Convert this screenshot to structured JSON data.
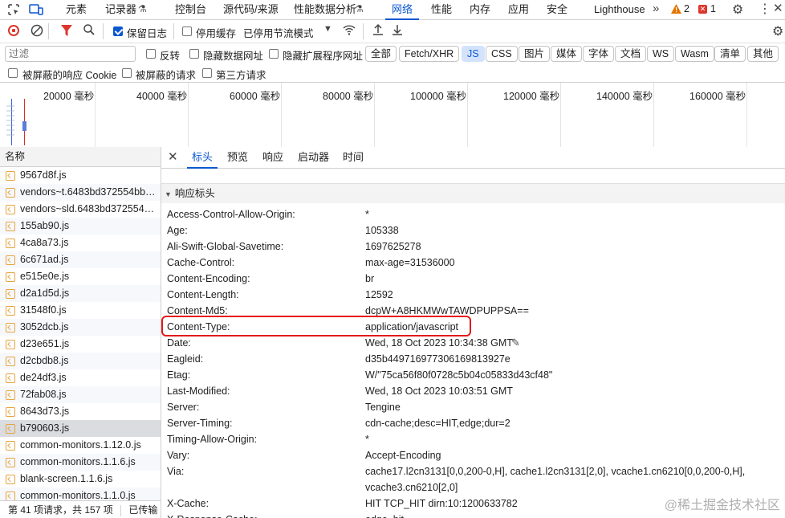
{
  "top_tabs": [
    "元素",
    "记录器",
    "控制台",
    "源代码/来源",
    "性能数据分析",
    "网络",
    "性能",
    "内存",
    "应用",
    "安全",
    "Lighthouse"
  ],
  "top_badges": {
    "warnings": "2",
    "errors": "1"
  },
  "toolbar": {
    "preserve_log": "保留日志",
    "disable_cache": "停用缓存",
    "throttle": "已停用节流模式"
  },
  "filter": {
    "placeholder": "过滤",
    "invert": "反转",
    "hide_data_urls": "隐藏数据网址",
    "hide_ext_urls": "隐藏扩展程序网址"
  },
  "type_filters": [
    "全部",
    "Fetch/XHR",
    "JS",
    "CSS",
    "图片",
    "媒体",
    "字体",
    "文档",
    "WS",
    "Wasm",
    "清单",
    "其他"
  ],
  "type_selected": "JS",
  "filter2": [
    "被屏蔽的响应 Cookie",
    "被屏蔽的请求",
    "第三方请求"
  ],
  "timeline_ticks": [
    "20000 毫秒",
    "40000 毫秒",
    "60000 毫秒",
    "80000 毫秒",
    "100000 毫秒",
    "120000 毫秒",
    "140000 毫秒",
    "160000 毫秒"
  ],
  "left": {
    "header": "名称",
    "files": [
      "9567d8f.js",
      "vendors~t.6483bd372554bb…",
      "vendors~sld.6483bd372554b…",
      "155ab90.js",
      "4ca8a73.js",
      "6c671ad.js",
      "e515e0e.js",
      "d2a1d5d.js",
      "31548f0.js",
      "3052dcb.js",
      "d23e651.js",
      "d2cbdb8.js",
      "de24df3.js",
      "72fab08.js",
      "8643d73.js",
      "b790603.js",
      "common-monitors.1.12.0.js",
      "common-monitors.1.1.6.js",
      "blank-screen.1.1.6.js",
      "common-monitors.1.1.0.js"
    ],
    "selected_file": "b790603.js",
    "status": "第 41 项请求，共 157 项",
    "status2": "已传输"
  },
  "detail_tabs": [
    "标头",
    "预览",
    "响应",
    "启动器",
    "时间"
  ],
  "section_title": "响应标头",
  "headers": [
    {
      "k": "Access-Control-Allow-Origin:",
      "v": "*"
    },
    {
      "k": "Age:",
      "v": "105338"
    },
    {
      "k": "Ali-Swift-Global-Savetime:",
      "v": "1697625278"
    },
    {
      "k": "Cache-Control:",
      "v": "max-age=31536000"
    },
    {
      "k": "Content-Encoding:",
      "v": "br"
    },
    {
      "k": "Content-Length:",
      "v": "12592"
    },
    {
      "k": "Content-Md5:",
      "v": "dcpW+A8HKMWwTAWDPUPPSA=="
    },
    {
      "k": "Content-Type:",
      "v": "application/javascript"
    },
    {
      "k": "Date:",
      "v": "Wed, 18 Oct 2023 10:34:38 GMT"
    },
    {
      "k": "Eagleid:",
      "v": "d35b4497169773061698​13927e"
    },
    {
      "k": "Etag:",
      "v": "W/\"75ca56f80f0728c5b04c05833d43cf48\""
    },
    {
      "k": "Last-Modified:",
      "v": "Wed, 18 Oct 2023 10:03:51 GMT"
    },
    {
      "k": "Server:",
      "v": "Tengine"
    },
    {
      "k": "Server-Timing:",
      "v": "cdn-cache;desc=HIT,edge;dur=2"
    },
    {
      "k": "Timing-Allow-Origin:",
      "v": "*"
    },
    {
      "k": "Vary:",
      "v": "Accept-Encoding"
    },
    {
      "k": "Via:",
      "v": "cache17.l2cn3131[0,0,200-0,H], cache1.l2cn3131[2,0], vcache1.cn6210[0,0,200-0,H],"
    },
    {
      "k": "",
      "v": "vcache3.cn6210[2,0]"
    },
    {
      "k": "X-Cache:",
      "v": "HIT TCP_HIT dirn:10:1200633782"
    },
    {
      "k": "X-Response-Cache:",
      "v": "edge_hit"
    }
  ],
  "watermark": "@稀土掘金技术社区"
}
